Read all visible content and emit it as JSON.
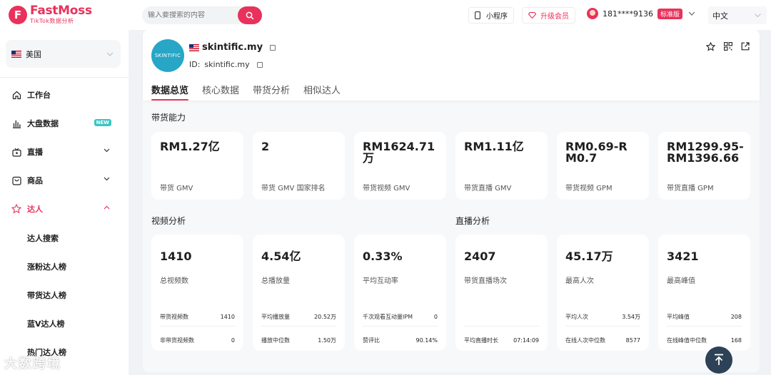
{
  "app": {
    "logo_mark": "F",
    "name": "FastMoss",
    "subtitle": "TikTok数据分析"
  },
  "search": {
    "placeholder": "输入要搜索的内容"
  },
  "header": {
    "miniapp_label": "小程序",
    "upgrade_label": "升级会员",
    "user_phone": "181****9136",
    "plan_badge": "标准版",
    "language": "中文"
  },
  "sidebar": {
    "country": "美国",
    "items": [
      {
        "label": "工作台",
        "icon": "home-icon"
      },
      {
        "label": "大盘数据",
        "icon": "bar-chart-icon",
        "badge": "NEW"
      },
      {
        "label": "直播",
        "icon": "live-tv-icon"
      },
      {
        "label": "商品",
        "icon": "shopping-bag-icon"
      },
      {
        "label": "达人",
        "icon": "star-icon"
      }
    ],
    "sub_items": [
      "达人搜索",
      "涨粉达人榜",
      "带货达人榜",
      "蓝V达人榜",
      "热门达人榜"
    ]
  },
  "profile": {
    "avatar_text": "SKINTIFIC",
    "name": "skintific.my",
    "id_label": "ID:",
    "id_value": "skintific.my",
    "tabs": [
      "数据总览",
      "核心数据",
      "带货分析",
      "相似达人"
    ]
  },
  "sales": {
    "title": "带货能力",
    "cards": [
      {
        "value": "RM1.27亿",
        "label": "带货 GMV"
      },
      {
        "value": "2",
        "label": "带货 GMV 国家排名"
      },
      {
        "value": "RM1624.71万",
        "label": "带货视频 GMV"
      },
      {
        "value": "RM1.11亿",
        "label": "带货直播 GMV"
      },
      {
        "value": "RM0.69-RM0.7",
        "label": "带货视频 GPM"
      },
      {
        "value": "RM1299.95-RM1396.66",
        "label": "带货直播 GPM"
      }
    ]
  },
  "video": {
    "title": "视频分析",
    "cards": [
      {
        "value": "1410",
        "label": "总视频数",
        "rows": [
          {
            "k": "带货视频数",
            "v": "1410"
          },
          {
            "k": "非带货视频数",
            "v": "0"
          }
        ]
      },
      {
        "value": "4.54亿",
        "label": "总播放量",
        "rows": [
          {
            "k": "平均播放量",
            "v": "20.52万"
          },
          {
            "k": "播放中位数",
            "v": "1.50万"
          }
        ]
      },
      {
        "value": "0.33%",
        "label": "平均互动率",
        "rows": [
          {
            "k": "千次观看互动量IPM",
            "v": "0"
          },
          {
            "k": "赞评比",
            "v": "90.14%"
          }
        ]
      }
    ]
  },
  "live": {
    "title": "直播分析",
    "cards": [
      {
        "value": "2407",
        "label": "带货直播场次",
        "rows": [
          {
            "k": "平均直播时长",
            "v": "07:14:09"
          }
        ]
      },
      {
        "value": "45.17万",
        "label": "最高人次",
        "rows": [
          {
            "k": "平均人次",
            "v": "3.54万"
          },
          {
            "k": "在线人次中位数",
            "v": "8577"
          }
        ]
      },
      {
        "value": "3421",
        "label": "最高峰值",
        "rows": [
          {
            "k": "平均峰值",
            "v": "208"
          },
          {
            "k": "在线峰值中位数",
            "v": "168"
          }
        ]
      }
    ]
  },
  "watermark": "大数跨境"
}
